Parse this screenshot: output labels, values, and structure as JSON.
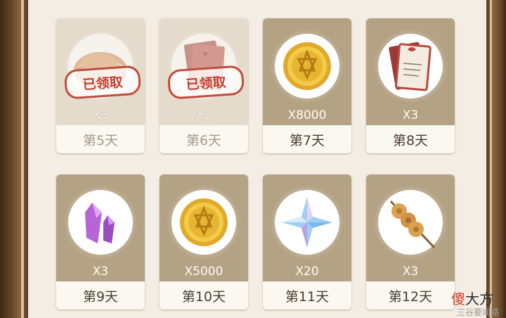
{
  "rewards": [
    {
      "qty": "X3",
      "day": "第5天",
      "claimed": true,
      "stamp": "已领取",
      "icon": "bread-basket-icon"
    },
    {
      "qty": "X2",
      "day": "第6天",
      "claimed": true,
      "stamp": "已领取",
      "icon": "red-book-icon"
    },
    {
      "qty": "X8000",
      "day": "第7天",
      "claimed": false,
      "icon": "gold-coin-icon"
    },
    {
      "qty": "X3",
      "day": "第8天",
      "claimed": false,
      "icon": "red-book-icon"
    },
    {
      "qty": "X3",
      "day": "第9天",
      "claimed": false,
      "icon": "purple-crystal-icon"
    },
    {
      "qty": "X5000",
      "day": "第10天",
      "claimed": false,
      "icon": "gold-coin-icon"
    },
    {
      "qty": "X20",
      "day": "第11天",
      "claimed": false,
      "icon": "star-crystal-icon"
    },
    {
      "qty": "X3",
      "day": "第12天",
      "claimed": false,
      "icon": "meatball-skewer-icon"
    }
  ],
  "watermark": {
    "text_a": "傻",
    "text_b": "大方",
    "sub": "三谷要闻路"
  },
  "colors": {
    "claimed_card": "#e4dbcd",
    "unclaimed_card": "#b4a284",
    "stamp_red": "#c14c3c",
    "panel_bg": "#f3ede3"
  }
}
